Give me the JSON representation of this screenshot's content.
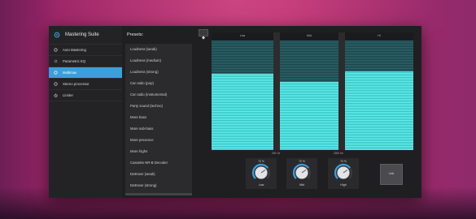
{
  "sidebar": {
    "title": "Mastering Suite",
    "items": [
      {
        "label": "Auto Mastering",
        "icon": "gear-icon"
      },
      {
        "label": "Parametric EQ",
        "icon": "dot-icon"
      },
      {
        "label": "Multimax",
        "icon": "gear-icon",
        "active": true
      },
      {
        "label": "Stereo processor",
        "icon": "gear-icon"
      },
      {
        "label": "Limiter",
        "icon": "power-icon"
      }
    ]
  },
  "presets": {
    "header": "Presets:",
    "items": [
      "Loudness (weak)",
      "Loudness (medium)",
      "Loudness (strong)",
      "Car radio (pop)",
      "Car radio (instrumental)",
      "Party sound (techno)",
      "More bass",
      "More sub-bass",
      "More presence",
      "More highs",
      "Cassette NR-B Decoder",
      "DeEsser (weak)",
      "DeEsser (strong)"
    ]
  },
  "bands": [
    {
      "name": "Low",
      "level": 0.7
    },
    {
      "name": "Mid",
      "level": 0.62
    },
    {
      "name": "Hi",
      "level": 0.72
    }
  ],
  "crossover": [
    "200 Hz",
    "3000 Hz"
  ],
  "knobs": [
    {
      "percent": "70 %",
      "label": "Low",
      "value": 0.7
    },
    {
      "percent": "70 %",
      "label": "Mid",
      "value": 0.7
    },
    {
      "percent": "70 %",
      "label": "High",
      "value": 0.7
    }
  ],
  "link_button": "Link",
  "colors": {
    "accent": "#3c9fd8",
    "meter": "#6ef3ef"
  }
}
